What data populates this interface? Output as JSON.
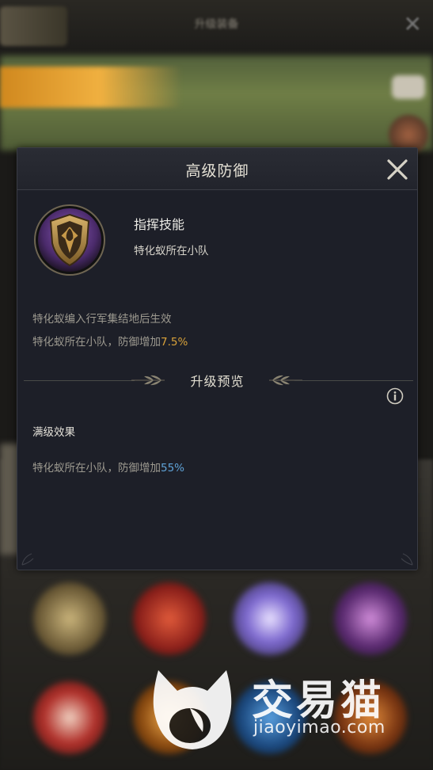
{
  "background": {
    "top_title": "升级装备"
  },
  "dialog": {
    "title": "高级防御",
    "skill_type": "指挥技能",
    "skill_scope": "特化蚁所在小队",
    "effect_condition": "特化蚁编入行军集结地后生效",
    "current_effect_text": "特化蚁所在小队，防御增加",
    "current_effect_value": "7.5%",
    "section_title": "升级预览",
    "max_level_label": "满级效果",
    "max_effect_text": "特化蚁所在小队，防御增加",
    "max_effect_value": "55%"
  },
  "watermark": {
    "brand": "交易猫",
    "url": "jiaoyimao.com"
  },
  "colors": {
    "accent_gold": "#d9a23a",
    "accent_blue": "#5fa3d8",
    "dialog_bg": "#1d1f28"
  },
  "icons": [
    "close-icon",
    "shield-skill-icon",
    "info-icon",
    "laurel-left-icon",
    "laurel-right-icon"
  ]
}
